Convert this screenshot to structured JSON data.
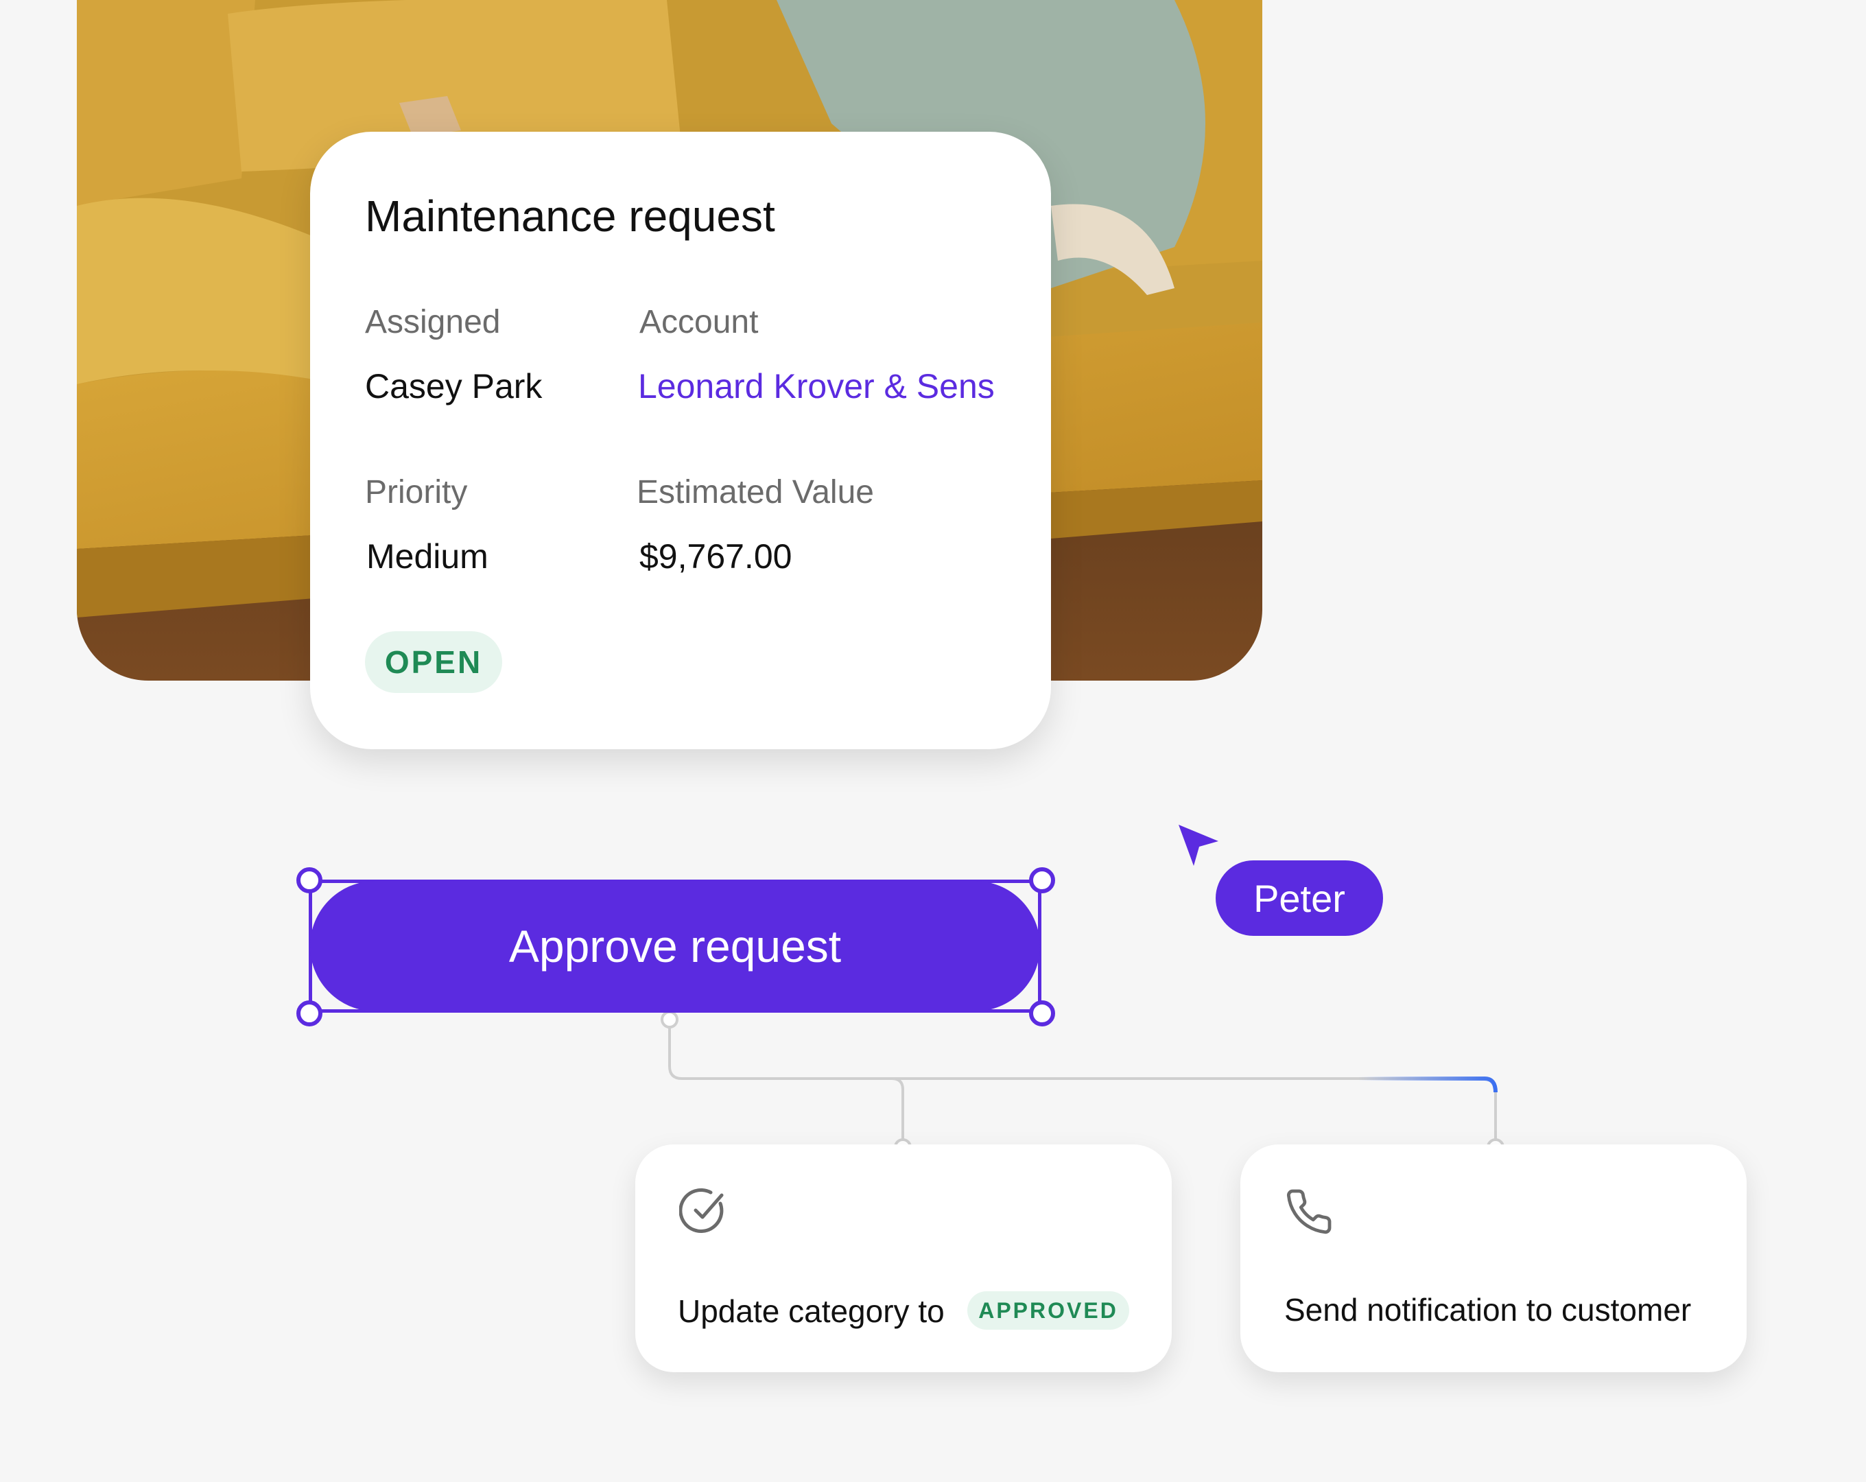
{
  "request_card": {
    "title": "Maintenance request",
    "assigned_label": "Assigned",
    "assigned_value": "Casey Park",
    "account_label": "Account",
    "account_value": "Leonard Krover & Sens",
    "priority_label": "Priority",
    "priority_value": "Medium",
    "estimated_value_label": "Estimated Value",
    "estimated_value": "$9,767.00",
    "status": "OPEN"
  },
  "approve_button": {
    "label": "Approve request"
  },
  "collaborator": {
    "name": "Peter"
  },
  "actions": [
    {
      "icon": "check-circle-icon",
      "text": "Update category to",
      "badge": "APPROVED"
    },
    {
      "icon": "phone-icon",
      "text": "Send notification to customer"
    }
  ],
  "colors": {
    "accent": "#5b2be0",
    "status_green": "#1f8a55",
    "status_green_bg": "#e7f5ee",
    "connector_blue": "#3b6ff0"
  }
}
